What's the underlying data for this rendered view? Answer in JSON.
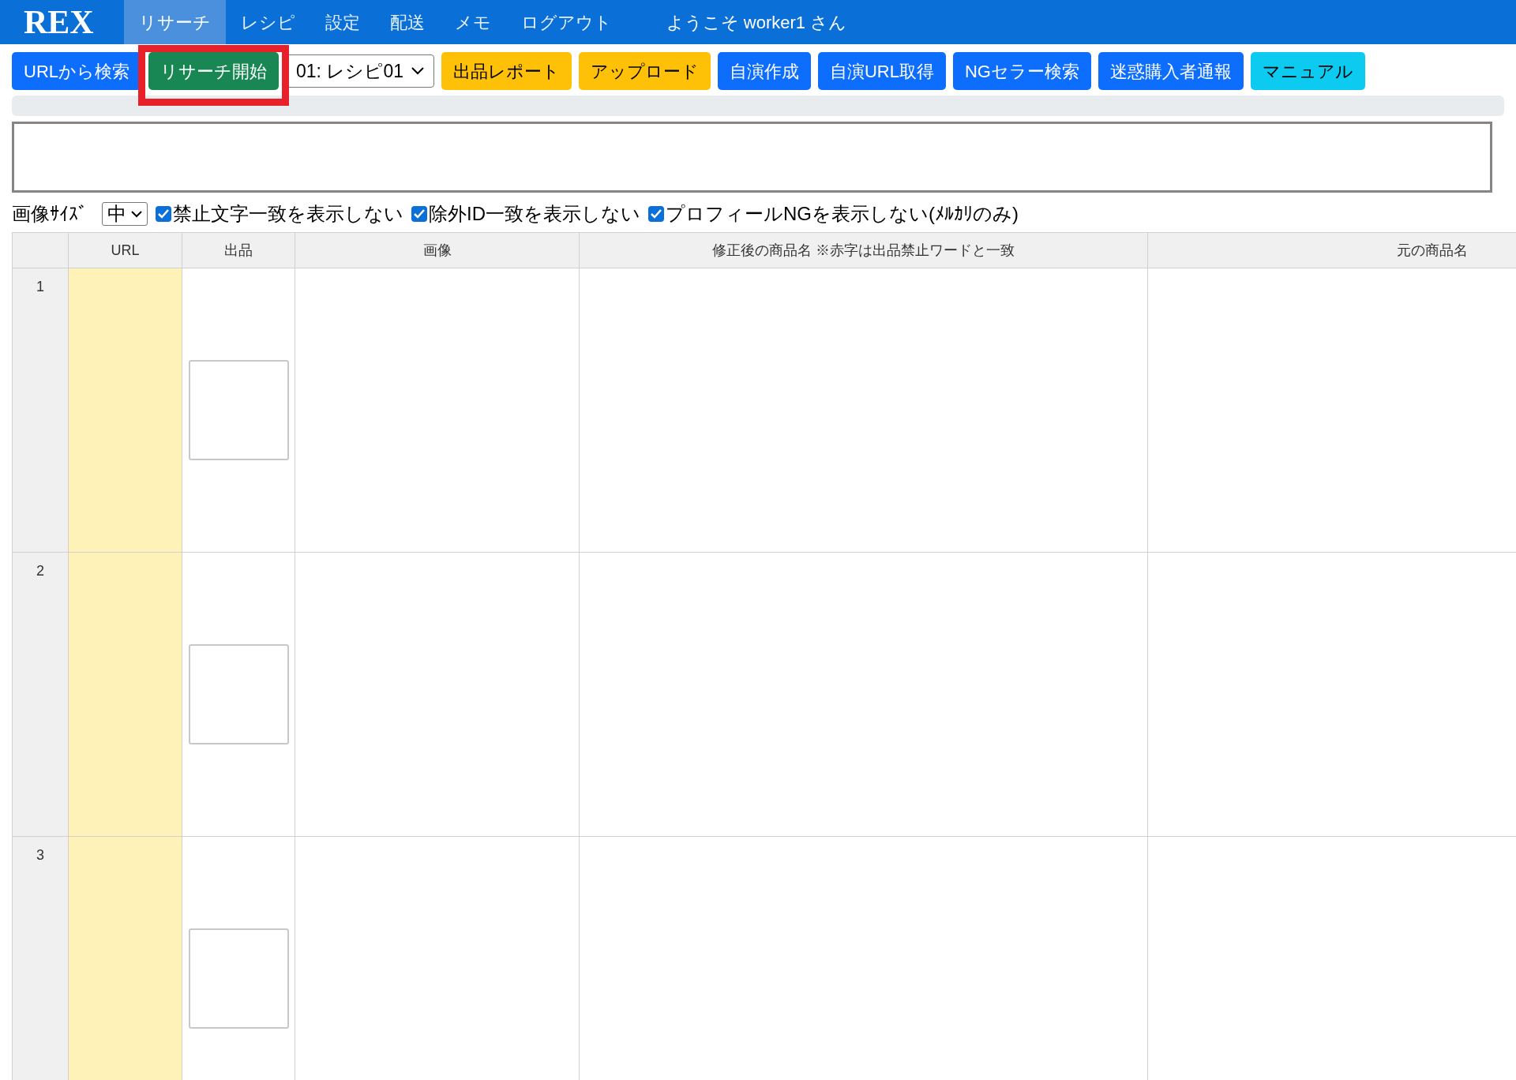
{
  "navbar": {
    "brand": "REX",
    "items": [
      {
        "label": "リサーチ",
        "selected": true
      },
      {
        "label": "レシピ",
        "selected": false
      },
      {
        "label": "設定",
        "selected": false
      },
      {
        "label": "配送",
        "selected": false
      },
      {
        "label": "メモ",
        "selected": false
      },
      {
        "label": "ログアウト",
        "selected": false
      }
    ],
    "welcome": "ようこそ worker1 さん"
  },
  "toolbar": [
    {
      "kind": "button",
      "label": "URLから検索",
      "color": "#0d6efd",
      "highlighted": false
    },
    {
      "kind": "button",
      "label": "リサーチ開始",
      "color": "#198754",
      "highlighted": true
    },
    {
      "kind": "select",
      "value": "01: レシピ01"
    },
    {
      "kind": "button",
      "label": "出品レポート",
      "color": "#ffc107",
      "highlighted": false
    },
    {
      "kind": "button",
      "label": "アップロード",
      "color": "#ffc107",
      "highlighted": false
    },
    {
      "kind": "button",
      "label": "自演作成",
      "color": "#0d6efd",
      "highlighted": false
    },
    {
      "kind": "button",
      "label": "自演URL取得",
      "color": "#0d6efd",
      "highlighted": false
    },
    {
      "kind": "button",
      "label": "NGセラー検索",
      "color": "#0d6efd",
      "highlighted": false
    },
    {
      "kind": "button",
      "label": "迷惑購入者通報",
      "color": "#0d6efd",
      "highlighted": false
    },
    {
      "kind": "button",
      "label": "マニュアル",
      "color": "#0dcaf0",
      "highlighted": false
    }
  ],
  "progress": {
    "level": 0
  },
  "options": {
    "image_size_label": "画像ｻｲｽﾞ",
    "image_size": "中",
    "checkboxes": [
      {
        "label": "禁止文字一致を表示しない",
        "checked": true
      },
      {
        "label": "除外ID一致を表示しない",
        "checked": true
      },
      {
        "label": "プロフィールNGを表示しない(ﾒﾙｶﾘのみ)",
        "checked": true
      }
    ]
  },
  "table": {
    "columns": [
      "URL",
      "出品",
      "画像",
      "修正後の商品名 ※赤字は出品禁止ワードと一致",
      "元の商品名"
    ],
    "rows": [
      {
        "number": "1"
      },
      {
        "number": "2"
      },
      {
        "number": "3"
      }
    ]
  }
}
